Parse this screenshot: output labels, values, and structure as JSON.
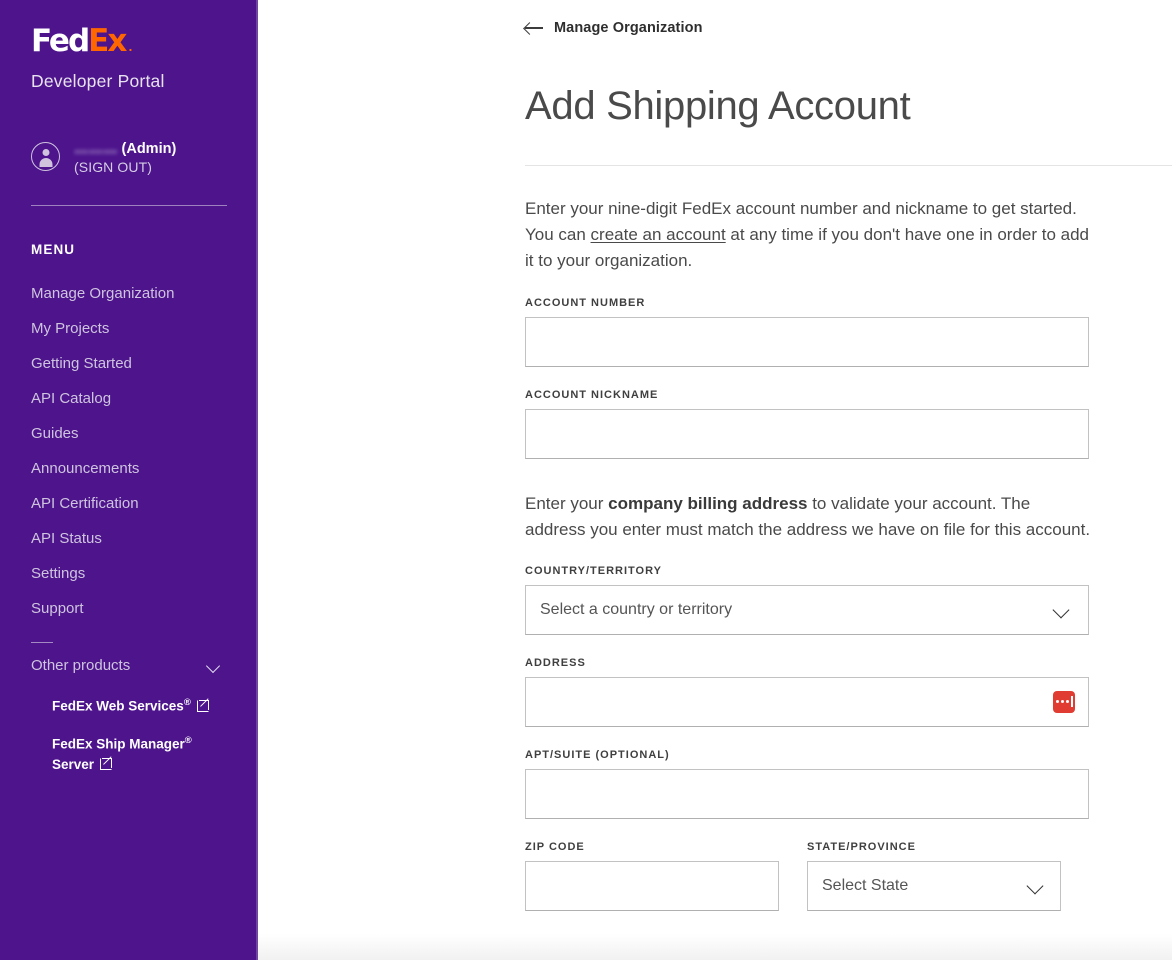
{
  "sidebar": {
    "logo": {
      "part1": "Fed",
      "part2": "Ex",
      "registered": "."
    },
    "portal_name": "Developer Portal",
    "user": {
      "name_redacted": "………",
      "name_suffix": " (Admin)",
      "sign_out": "(SIGN OUT)",
      "avatar_icon": "user-avatar-icon"
    },
    "menu_title": "MENU",
    "items": [
      {
        "label": "Manage Organization"
      },
      {
        "label": "My Projects"
      },
      {
        "label": "Getting Started"
      },
      {
        "label": "API Catalog"
      },
      {
        "label": "Guides"
      },
      {
        "label": "Announcements"
      },
      {
        "label": "API Certification"
      },
      {
        "label": "API Status"
      },
      {
        "label": "Settings"
      },
      {
        "label": "Support"
      }
    ],
    "other_products": {
      "label": "Other products",
      "chevron_icon": "chevron-down-icon",
      "links": [
        {
          "label": "FedEx Web Services",
          "sup": "®",
          "label2": "",
          "icon": "external-link-icon"
        },
        {
          "label": "FedEx Ship Manager",
          "sup": "®",
          "label2": "Server",
          "icon": "external-link-icon"
        }
      ]
    }
  },
  "main": {
    "breadcrumb": {
      "icon": "arrow-left-icon",
      "label": "Manage Organization"
    },
    "page_title": "Add Shipping Account",
    "intro": {
      "before_link": "Enter your nine-digit FedEx account number and nickname to get started. You can ",
      "link": "create an account",
      "after_link": " at any time if you don't have one in order to add it to your organization."
    },
    "billing": {
      "before_bold": "Enter your ",
      "bold": "company billing address",
      "after_bold": " to validate your account. The address you enter must match the address we have on file for this account."
    },
    "fields": {
      "account_number": {
        "label": "ACCOUNT NUMBER",
        "value": "",
        "placeholder": ""
      },
      "account_nickname": {
        "label": "ACCOUNT NICKNAME",
        "value": "",
        "placeholder": ""
      },
      "country": {
        "label": "COUNTRY/TERRITORY",
        "value": "Select a country or territory",
        "chevron_icon": "chevron-down-icon"
      },
      "address": {
        "label": "ADDRESS",
        "value": "",
        "placeholder": "",
        "icon": "lastpass-autofill-icon"
      },
      "apt_suite": {
        "label": "APT/SUITE (OPTIONAL)",
        "value": "",
        "placeholder": ""
      },
      "zip_code": {
        "label": "ZIP CODE",
        "value": "",
        "placeholder": ""
      },
      "state_province": {
        "label": "STATE/PROVINCE",
        "value": "Select State",
        "chevron_icon": "chevron-down-icon"
      }
    }
  },
  "colors": {
    "brand_purple": "#4d148c",
    "brand_orange": "#ff6600",
    "autofill_red": "#e03c31",
    "body_text": "#4a4a4a",
    "border": "#c2c2c2"
  }
}
